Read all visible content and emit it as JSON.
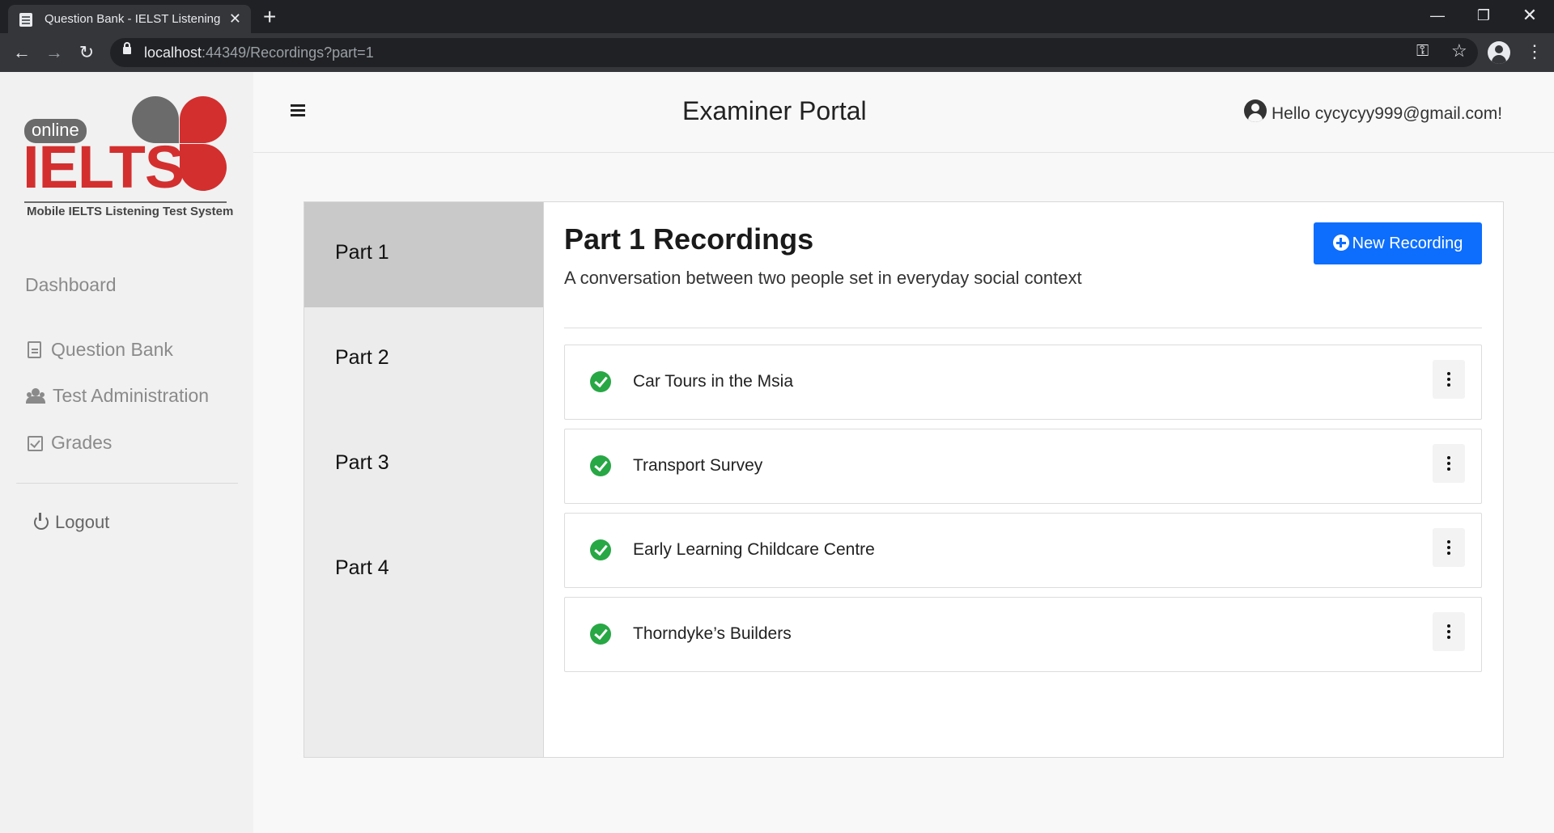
{
  "browser": {
    "tab_title": "Question Bank - IELST Listening",
    "url_host": "localhost",
    "url_rest": ":44349/Recordings?part=1"
  },
  "logo": {
    "online": "online",
    "ielts": "IELTS",
    "tagline": "Mobile IELTS Listening Test System"
  },
  "sidebar": {
    "dashboard": "Dashboard",
    "items": [
      {
        "label": "Question Bank",
        "icon": "document-icon"
      },
      {
        "label": "Test Administration",
        "icon": "users-icon"
      },
      {
        "label": "Grades",
        "icon": "checkbox-icon"
      }
    ],
    "logout": "Logout"
  },
  "header": {
    "title": "Examiner Portal",
    "greeting": "Hello cycycyy999@gmail.com!"
  },
  "parts": [
    {
      "label": "Part 1",
      "active": true
    },
    {
      "label": "Part 2",
      "active": false
    },
    {
      "label": "Part 3",
      "active": false
    },
    {
      "label": "Part 4",
      "active": false
    }
  ],
  "content": {
    "title": "Part 1 Recordings",
    "subtitle": "A conversation between two people set in everyday social context",
    "new_button": "New Recording"
  },
  "recordings": [
    {
      "name": "Car Tours in the Msia",
      "status": "complete"
    },
    {
      "name": "Transport Survey",
      "status": "complete"
    },
    {
      "name": "Early Learning Childcare Centre",
      "status": "complete"
    },
    {
      "name": "Thorndyke’s Builders",
      "status": "complete"
    }
  ],
  "colors": {
    "primary": "#0d6efd",
    "success": "#28a745",
    "brand_red": "#d32f2f",
    "brand_grey": "#6b6b6b"
  }
}
